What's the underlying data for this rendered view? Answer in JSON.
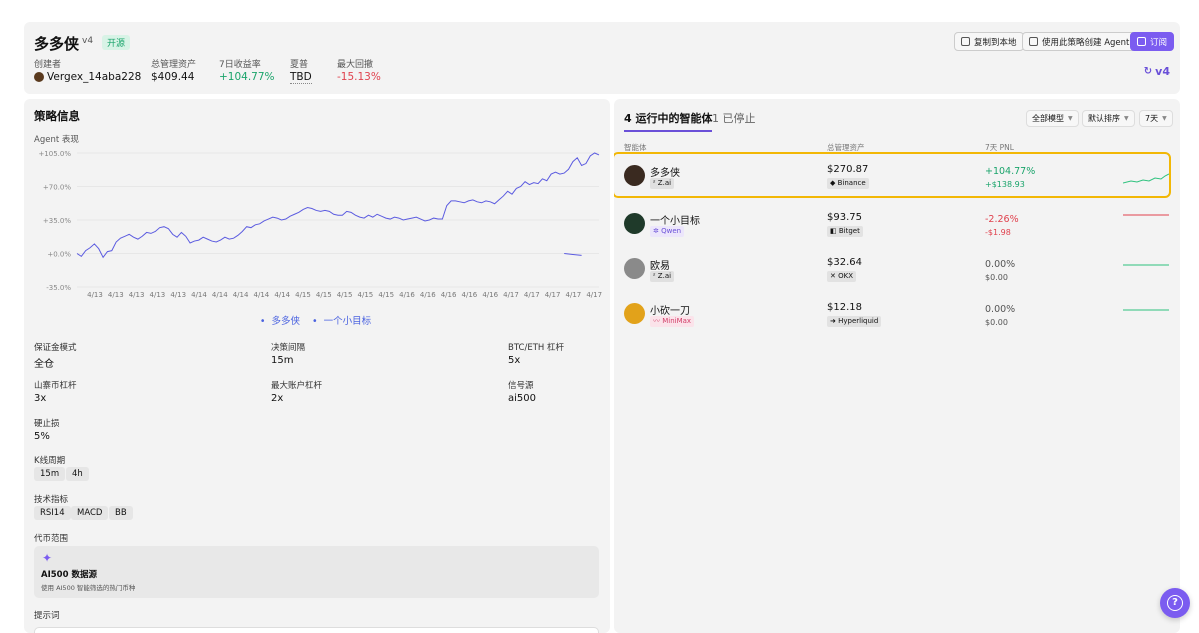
{
  "header": {
    "title": "多多侠",
    "version": "v4",
    "open_badge": "开源",
    "stats": [
      {
        "label": "创建者",
        "value": "Vergex_14aba228"
      },
      {
        "label": "总管理资产",
        "value": "$409.44"
      },
      {
        "label": "7日收益率",
        "value": "+104.77%"
      },
      {
        "label": "夏普",
        "value": "TBD"
      },
      {
        "label": "最大回撤",
        "value": "-15.13%"
      }
    ],
    "buttons": {
      "copy": "复制到本地",
      "create_agent": "使用此策略创建 Agent",
      "subscribe": "订阅"
    },
    "history_version": "v4"
  },
  "strategy": {
    "section_title": "策略信息",
    "chart_label": "Agent 表现",
    "legend": [
      "多多侠",
      "一个小目标"
    ],
    "params": {
      "margin_mode_label": "保证金模式",
      "margin_mode": "全仓",
      "decision_interval_label": "决策间隔",
      "decision_interval": "15m",
      "btc_eth_leverage_label": "BTC/ETH 杠杆",
      "btc_eth_leverage": "5x",
      "altcoin_leverage_label": "山寨币杠杆",
      "altcoin_leverage": "3x",
      "max_account_leverage_label": "最大账户杠杆",
      "max_account_leverage": "2x",
      "signal_source_label": "信号源",
      "signal_source": "ai500",
      "hard_stop_label": "硬止损",
      "hard_stop": "5%",
      "kline_label": "K线周期",
      "kline": [
        "15m",
        "4h"
      ],
      "indicators_label": "技术指标",
      "indicators": [
        "RSI14",
        "MACD",
        "BB"
      ],
      "coin_scope_label": "代币范围",
      "source_title": "AI500 数据源",
      "source_desc": "使用 AI500 智能筛选的热门币种",
      "prompt_label": "提示词"
    }
  },
  "chart_data": {
    "type": "line",
    "title": "",
    "xlabel": "",
    "ylabel": "",
    "yticks": [
      "+105.0%",
      "+70.0%",
      "+35.0%",
      "+0.0%",
      "-35.0%"
    ],
    "ylim": [
      -35,
      105
    ],
    "xticks": [
      "4/13",
      "4/13",
      "4/13",
      "4/13",
      "4/13",
      "4/14",
      "4/14",
      "4/14",
      "4/14",
      "4/14",
      "4/15",
      "4/15",
      "4/15",
      "4/15",
      "4/15",
      "4/16",
      "4/16",
      "4/16",
      "4/16",
      "4/16",
      "4/17",
      "4/17",
      "4/17",
      "4/17",
      "4/17"
    ],
    "x": [
      0,
      1,
      2,
      3,
      4,
      5,
      6,
      7,
      8,
      9,
      10,
      11,
      12,
      13,
      14,
      15,
      16,
      17,
      18,
      19,
      20,
      21,
      22,
      23,
      24,
      25,
      26,
      27,
      28,
      29,
      30,
      31,
      32,
      33,
      34,
      35,
      36,
      37,
      38,
      39,
      40,
      41,
      42,
      43,
      44,
      45,
      46,
      47,
      48,
      49,
      50,
      51,
      52,
      53,
      54,
      55,
      56,
      57,
      58,
      59,
      60,
      61,
      62,
      63,
      64,
      65,
      66,
      67,
      68,
      69,
      70,
      71,
      72,
      73,
      74,
      75,
      76,
      77,
      78,
      79,
      80,
      81,
      82,
      83,
      84,
      85,
      86,
      87,
      88,
      89,
      90,
      91,
      92,
      93,
      94,
      95,
      96,
      97,
      98,
      99,
      100,
      101,
      102,
      103,
      104,
      105,
      106,
      107,
      108,
      109,
      110,
      111,
      112,
      113,
      114,
      115,
      116,
      117,
      118,
      119,
      120
    ],
    "series": [
      {
        "name": "多多侠",
        "color": "#5b5be0",
        "values": [
          0,
          -3,
          3,
          6,
          10,
          5,
          -4,
          2,
          3,
          12,
          16,
          18,
          20,
          17,
          15,
          18,
          22,
          21,
          23,
          27,
          28,
          26,
          20,
          17,
          22,
          18,
          11,
          13,
          14,
          17,
          15,
          13,
          12,
          14,
          17,
          15,
          16,
          19,
          23,
          28,
          27,
          30,
          31,
          34,
          36,
          38,
          37,
          35,
          36,
          39,
          41,
          43,
          46,
          48,
          47,
          45,
          44,
          45,
          44,
          41,
          40,
          40,
          44,
          43,
          40,
          38,
          37,
          40,
          38,
          41,
          39,
          37,
          36,
          38,
          37,
          35,
          36,
          37,
          38,
          36,
          34,
          35,
          37,
          36,
          36,
          50,
          55,
          55,
          54,
          53,
          55,
          56,
          54,
          53,
          55,
          54,
          52,
          56,
          60,
          65,
          62,
          68,
          70,
          75,
          72,
          74,
          73,
          78,
          76,
          83,
          85,
          83,
          84,
          88,
          96,
          100,
          92,
          94,
          102,
          105,
          103
        ]
      },
      {
        "name": "一个小目标",
        "color": "#5b5be0",
        "values": [
          0,
          -1,
          -2
        ]
      }
    ]
  },
  "agents": {
    "tab_running": "4 运行中的智能体",
    "tab_stopped": "1 已停止",
    "filters": {
      "model": "全部模型",
      "sort": "默认排序",
      "period": "7天"
    },
    "columns": {
      "agent": "智能体",
      "aum": "总管理资产",
      "pnl": "7天 PNL"
    },
    "rows": [
      {
        "name": "多多侠",
        "model": "Z.ai",
        "aum": "$270.87",
        "exchange": "Binance",
        "pnl_pct": "+104.77%",
        "pnl_abs": "+$138.93",
        "spark_color": "#2ec27e",
        "avatar_color": "#3a2a20"
      },
      {
        "name": "一个小目标",
        "model": "Qwen",
        "aum": "$93.75",
        "exchange": "Bitget",
        "pnl_pct": "-2.26%",
        "pnl_abs": "-$1.98",
        "spark_color": "#e0424e",
        "avatar_color": "#1f3a2a"
      },
      {
        "name": "欧易",
        "model": "Z.ai",
        "aum": "$32.64",
        "exchange": "OKX",
        "pnl_pct": "0.00%",
        "pnl_abs": "$0.00",
        "spark_color": "#2ec27e",
        "avatar_color": "#6a6a6a"
      },
      {
        "name": "小砍一刀",
        "model": "MiniMax",
        "aum": "$12.18",
        "exchange": "Hyperliquid",
        "pnl_pct": "0.00%",
        "pnl_abs": "$0.00",
        "spark_color": "#2ec27e",
        "avatar_color": "#e2a21a"
      }
    ]
  }
}
